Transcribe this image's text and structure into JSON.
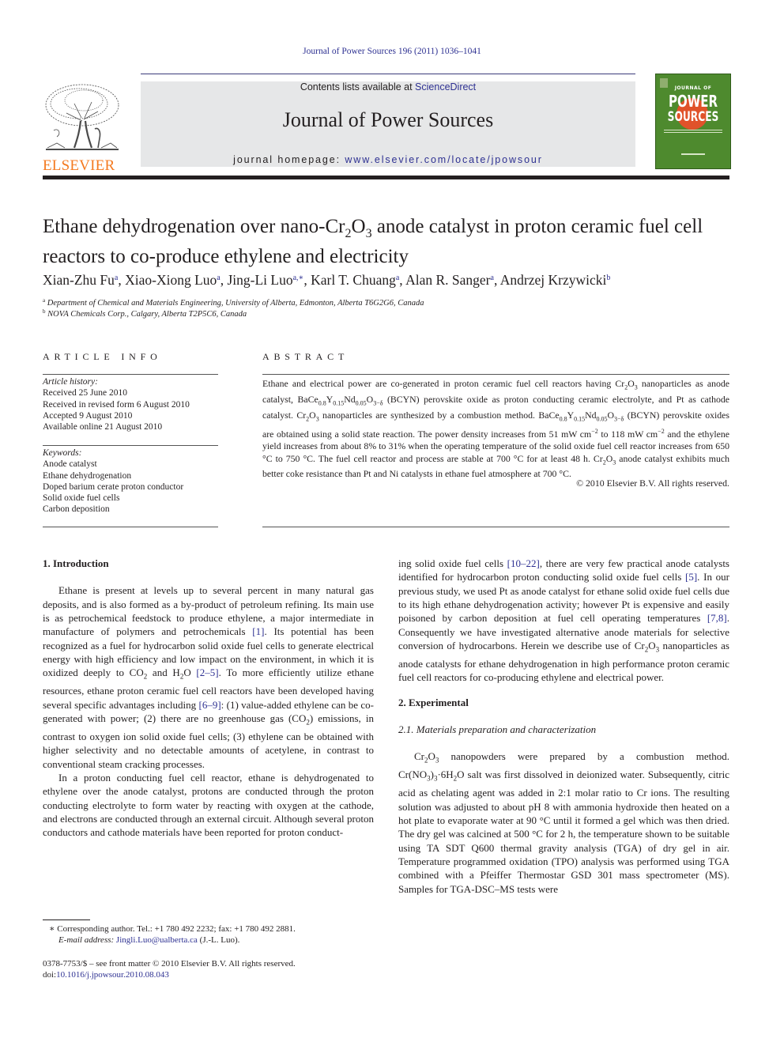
{
  "header": {
    "running_head": "Journal of Power Sources 196 (2011) 1036–1041",
    "contents_prefix": "Contents lists available at ",
    "contents_link": "ScienceDirect",
    "journal_name": "Journal of Power Sources",
    "homepage_prefix": "journal homepage: ",
    "homepage_link": "www.elsevier.com/locate/jpowsour",
    "publisher_logo_text": "ELSEVIER",
    "cover": {
      "line1": "JOURNAL OF",
      "line2": "POWER",
      "line3": "SOURCES"
    },
    "colors": {
      "publisher_orange": "#f47a20",
      "link_blue": "#2e3192",
      "cover_green": "#4e8a2e",
      "cover_orange": "#e0522a"
    }
  },
  "article": {
    "title_part1": "Ethane dehydrogenation over nano-Cr",
    "title_sub1": "2",
    "title_part2": "O",
    "title_sub2": "3",
    "title_part3": " anode catalyst in proton ceramic fuel cell reactors to co-produce ethylene and electricity",
    "authors": [
      {
        "name": "Xian-Zhu Fu",
        "aff": "a"
      },
      {
        "name": "Xiao-Xiong Luo",
        "aff": "a"
      },
      {
        "name": "Jing-Li Luo",
        "aff": "a,∗"
      },
      {
        "name": "Karl T. Chuang",
        "aff": "a"
      },
      {
        "name": "Alan R. Sanger",
        "aff": "a"
      },
      {
        "name": "Andrzej Krzywicki",
        "aff": "b"
      }
    ],
    "affiliations": [
      {
        "label": "a",
        "text": "Department of Chemical and Materials Engineering, University of Alberta, Edmonton, Alberta T6G2G6, Canada"
      },
      {
        "label": "b",
        "text": "NOVA Chemicals Corp., Calgary, Alberta T2P5C6, Canada"
      }
    ]
  },
  "article_info": {
    "heading": "ARTICLE INFO",
    "history_label": "Article history:",
    "history": [
      "Received 25 June 2010",
      "Received in revised form 6 August 2010",
      "Accepted 9 August 2010",
      "Available online 21 August 2010"
    ],
    "keywords_label": "Keywords:",
    "keywords": [
      "Anode catalyst",
      "Ethane dehydrogenation",
      "Doped barium cerate proton conductor",
      "Solid oxide fuel cells",
      "Carbon deposition"
    ]
  },
  "abstract": {
    "heading": "ABSTRACT",
    "copyright": "© 2010 Elsevier B.V. All rights reserved."
  },
  "sections": {
    "intro_heading": "1.  Introduction",
    "experimental_heading": "2.  Experimental",
    "subsection_heading": "2.1.  Materials preparation and characterization"
  },
  "citations": {
    "c1": "[1]",
    "c2_5": "[2–5]",
    "c6_9": "[6–9]",
    "c10_22": "[10–22]",
    "c5": "[5]",
    "c7_8": "[7,8]"
  },
  "footnotes": {
    "corresponding": "∗  Corresponding author. Tel.: +1 780 492 2232; fax: +1 780 492 2881.",
    "email_label": "E-mail address:",
    "email": "Jingli.Luo@ualberta.ca",
    "email_suffix": " (J.-L. Luo).",
    "front_matter": "0378-7753/$ – see front matter © 2010 Elsevier B.V. All rights reserved.",
    "doi_prefix": "doi:",
    "doi": "10.1016/j.jpowsour.2010.08.043"
  }
}
